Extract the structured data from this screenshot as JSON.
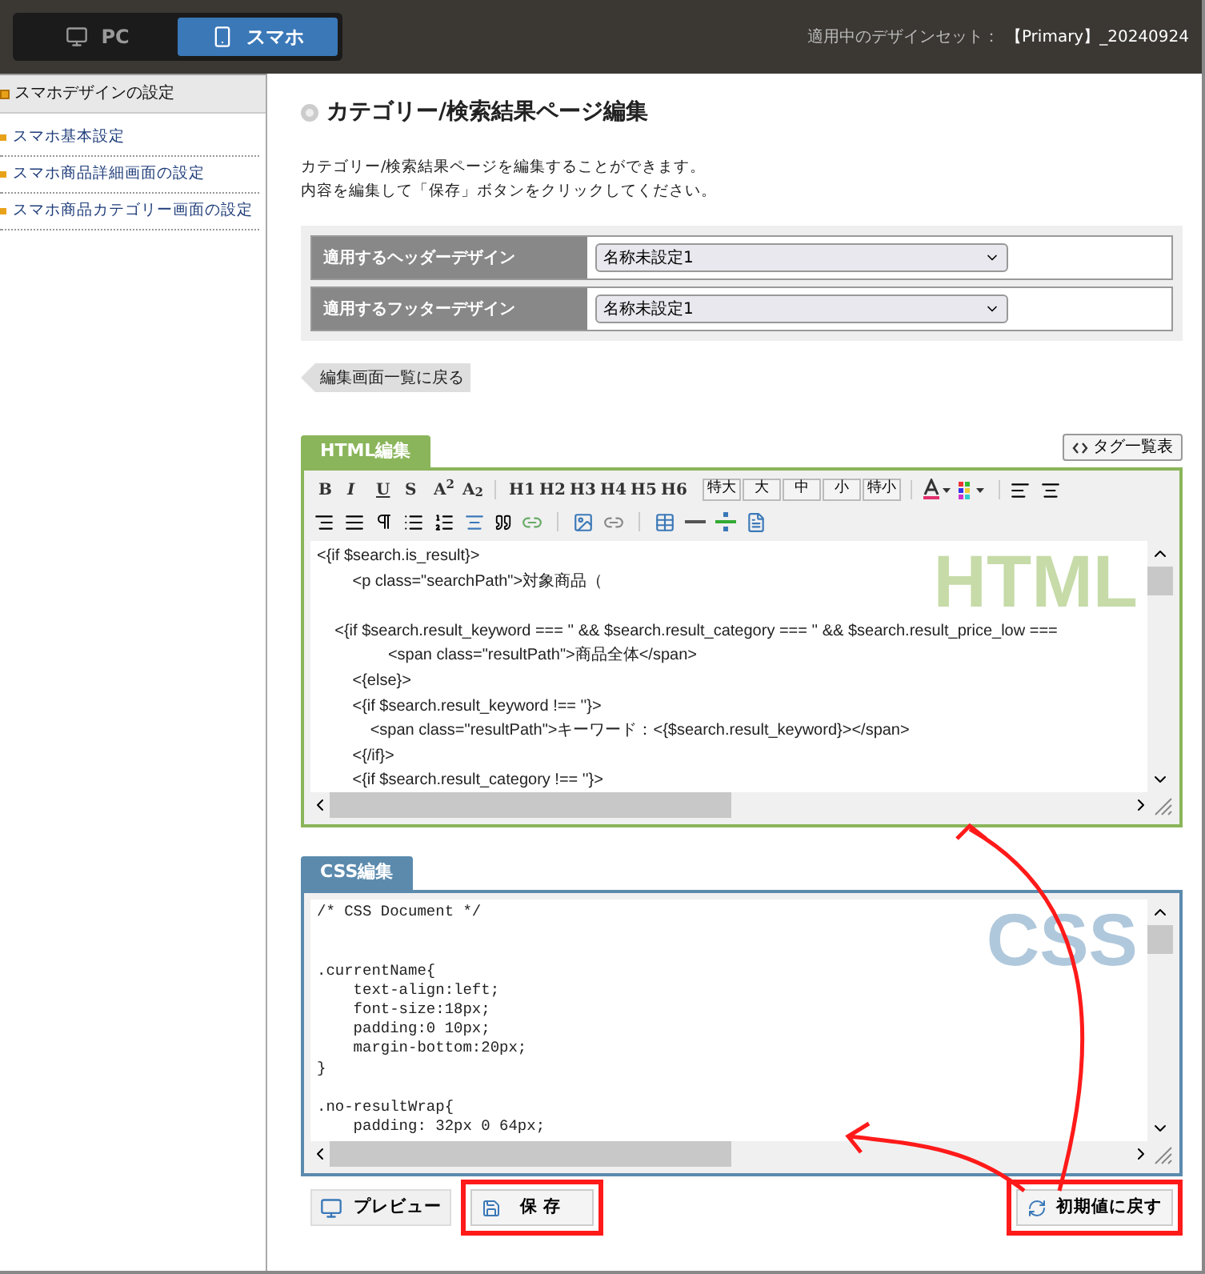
{
  "top_bar": {
    "device_tabs": [
      {
        "label": "PC",
        "selected": false
      },
      {
        "label": "スマホ",
        "selected": true
      }
    ],
    "design_set_label": "適用中のデザインセット：",
    "design_set_value": "【Primary】_20240924"
  },
  "sidebar": {
    "heading": "スマホデザインの設定",
    "items": [
      {
        "label": "スマホ基本設定"
      },
      {
        "label": "スマホ商品詳細画面の設定"
      },
      {
        "label": "スマホ商品カテゴリー画面の設定"
      }
    ]
  },
  "page": {
    "title": "カテゴリー/検索結果ページ編集",
    "description": [
      "カテゴリー/検索結果ページを編集することができます。",
      "内容を編集して「保存」ボタンをクリックしてください。"
    ]
  },
  "settings": [
    {
      "label": "適用するヘッダーデザイン",
      "value": "名称未設定1"
    },
    {
      "label": "適用するフッターデザイン",
      "value": "名称未設定1"
    }
  ],
  "back_button": "編集画面一覧に戻る",
  "html_editor": {
    "tab": "HTML編集",
    "tag_list_button": "タグ一覧表",
    "watermark": "HTML",
    "format_marks": [
      "B",
      "I",
      "U",
      "S",
      "A$^{2}$",
      "A$_{2}$"
    ],
    "headings": [
      "H1",
      "H2",
      "H3",
      "H4",
      "H5",
      "H6"
    ],
    "sizes": [
      "特大",
      "大",
      "中",
      "小",
      "特小"
    ],
    "lines": [
      {
        "kind": "code",
        "text": "<{if $search.is_result}>"
      },
      {
        "kind": "code",
        "text": "        <p class=\"searchPath\">対象商品（"
      },
      {
        "kind": "blank"
      },
      {
        "kind": "code",
        "text": "    <{if $search.result_keyword === '' && $search.result_category === '' && $search.result_price_low ==="
      },
      {
        "kind": "code",
        "text": "                <span class=\"resultPath\">商品全体</span>"
      },
      {
        "kind": "code",
        "text": "        <{else}>"
      },
      {
        "kind": "code",
        "text": "        <{if $search.result_keyword !== ''}>"
      },
      {
        "kind": "code",
        "text": "            <span class=\"resultPath\">キーワード：<{$search.result_keyword}></span>"
      },
      {
        "kind": "code",
        "text": "        <{/if}>"
      },
      {
        "kind": "code",
        "text": "        <{if $search.result_category !== ''}>"
      }
    ]
  },
  "css_editor": {
    "tab": "CSS編集",
    "watermark": "CSS",
    "lines": [
      {
        "kind": "code",
        "text": "/* CSS Document */"
      },
      {
        "kind": "blank"
      },
      {
        "kind": "blank"
      },
      {
        "kind": "code",
        "text": ".currentName{"
      },
      {
        "kind": "code",
        "text": "    text-align:left;"
      },
      {
        "kind": "code",
        "text": "    font-size:18px;"
      },
      {
        "kind": "code",
        "text": "    padding:0 10px;"
      },
      {
        "kind": "code",
        "text": "    margin-bottom:20px;"
      },
      {
        "kind": "code",
        "text": "}"
      },
      {
        "kind": "blank"
      },
      {
        "kind": "code",
        "text": ".no-resultWrap{"
      },
      {
        "kind": "code",
        "text": "    padding: 32px 0 64px;"
      }
    ]
  },
  "footer_buttons": {
    "preview": {
      "label": "プレビュー",
      "highlighted": false
    },
    "save": {
      "label": "保 存",
      "highlighted": true
    },
    "reset": {
      "label": "初期値に戻す",
      "highlighted": true
    }
  }
}
